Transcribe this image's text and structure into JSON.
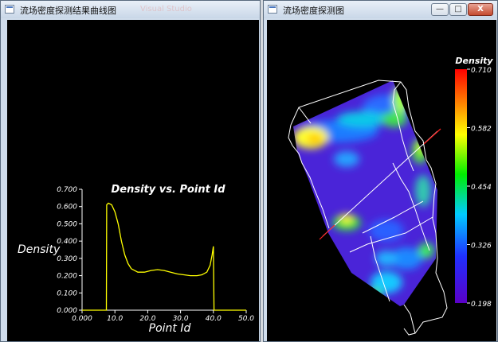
{
  "left_window": {
    "title": "流场密度探测结果曲线图",
    "ghost_title": "Visual Studio"
  },
  "right_window": {
    "title": "流场密度探测图",
    "buttons": {
      "minimize": "—",
      "maximize": "□",
      "close": "X"
    }
  },
  "colorbar": {
    "title": "Density",
    "ticks": [
      "0.710",
      "0.582",
      "0.454",
      "0.326",
      "0.198"
    ]
  },
  "chart_data": {
    "type": "line",
    "title": "Density vs. Point Id",
    "xlabel": "Point Id",
    "ylabel": "Density",
    "xlim": [
      0,
      50
    ],
    "ylim": [
      0,
      0.7
    ],
    "x_ticks": [
      "0.000",
      "10.0",
      "20.0",
      "30.0",
      "40.0",
      "50.0"
    ],
    "y_ticks": [
      "0.000",
      "0.100",
      "0.200",
      "0.300",
      "0.400",
      "0.500",
      "0.600",
      "0.700"
    ],
    "series": [
      {
        "color": "#ffff00",
        "x": [
          0,
          7.4,
          7.5,
          8,
          9,
          10,
          11,
          12,
          13,
          14,
          15,
          17,
          19,
          21,
          23,
          25,
          27,
          29,
          31,
          33,
          35,
          36.5,
          38,
          39,
          39.6,
          40,
          40.2,
          41,
          50
        ],
        "y": [
          0,
          0,
          0.61,
          0.62,
          0.61,
          0.57,
          0.5,
          0.4,
          0.32,
          0.27,
          0.24,
          0.22,
          0.22,
          0.23,
          0.235,
          0.23,
          0.22,
          0.21,
          0.205,
          0.2,
          0.2,
          0.205,
          0.22,
          0.26,
          0.32,
          0.37,
          0,
          0,
          0
        ]
      }
    ]
  }
}
